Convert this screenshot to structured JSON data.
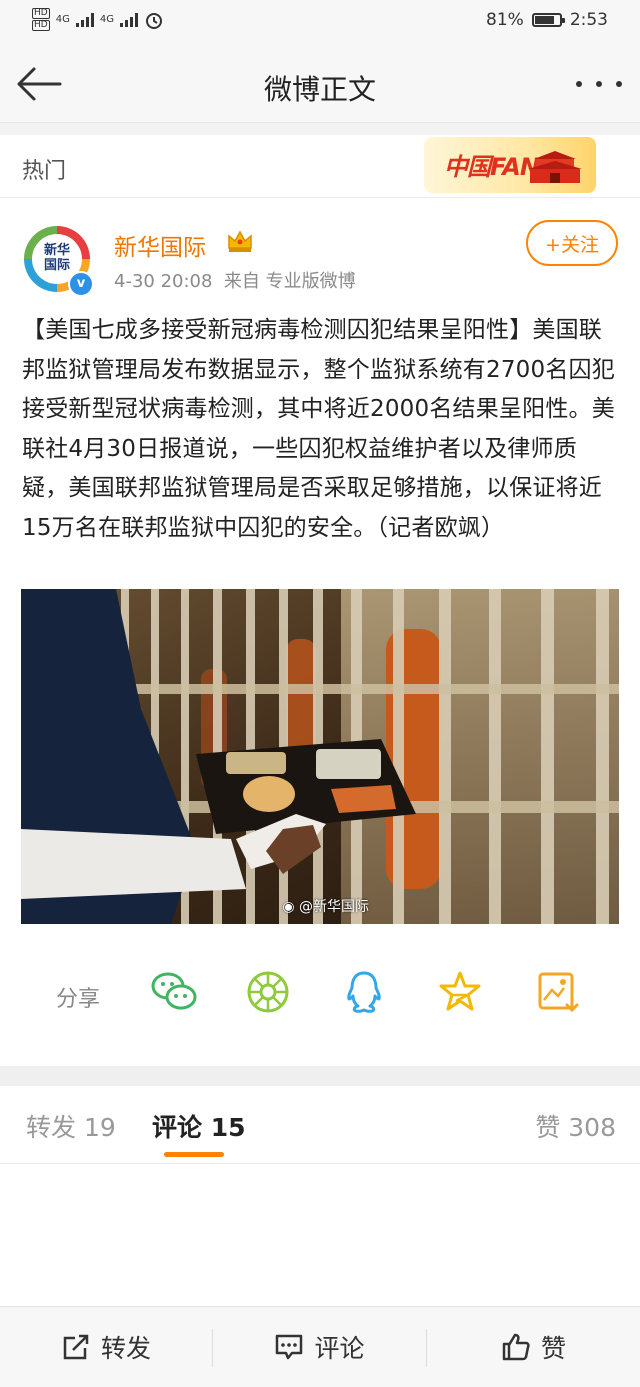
{
  "status_bar": {
    "network_1": "4G",
    "network_2": "4G",
    "battery": "81%",
    "battery_level": 0.81,
    "time": "2:53"
  },
  "header": {
    "title": "微博正文",
    "back_icon": "back-arrow-icon",
    "more_icon": "more-dots-icon"
  },
  "hot_bar": {
    "label": "热门",
    "banner_text": "中国FANS"
  },
  "post": {
    "author": "新华国际",
    "avatar_text": "新华\n国际",
    "time": "4-30 20:08",
    "source": "来自 专业版微博",
    "follow_label": "+关注",
    "text": "【美国七成多接受新冠病毒检测囚犯结果呈阳性】美国联邦监狱管理局发布数据显示，整个监狱系统有2700名囚犯接受新型冠状病毒检测，其中将近2000名结果呈阳性。美联社4月30日报道说，一些囚犯权益维护者以及律师质疑，美国联邦监狱管理局是否采取足够措施，以保证将近15万名在联邦监狱中囚犯的安全。（记者欧飒）",
    "image_watermark": "@新华国际"
  },
  "share": {
    "label": "分享",
    "targets": [
      "wechat-icon",
      "moments-icon",
      "qq-icon",
      "qzone-icon",
      "save-image-icon"
    ]
  },
  "tabs": {
    "repost": "转发 19",
    "comment": "评论 15",
    "like": "赞 308"
  },
  "bottom_bar": {
    "repost": "转发",
    "comment": "评论",
    "like": "赞"
  },
  "colors": {
    "accent": "#ff8200",
    "author_name": "#ef7600",
    "verified": "#2d91e8"
  }
}
